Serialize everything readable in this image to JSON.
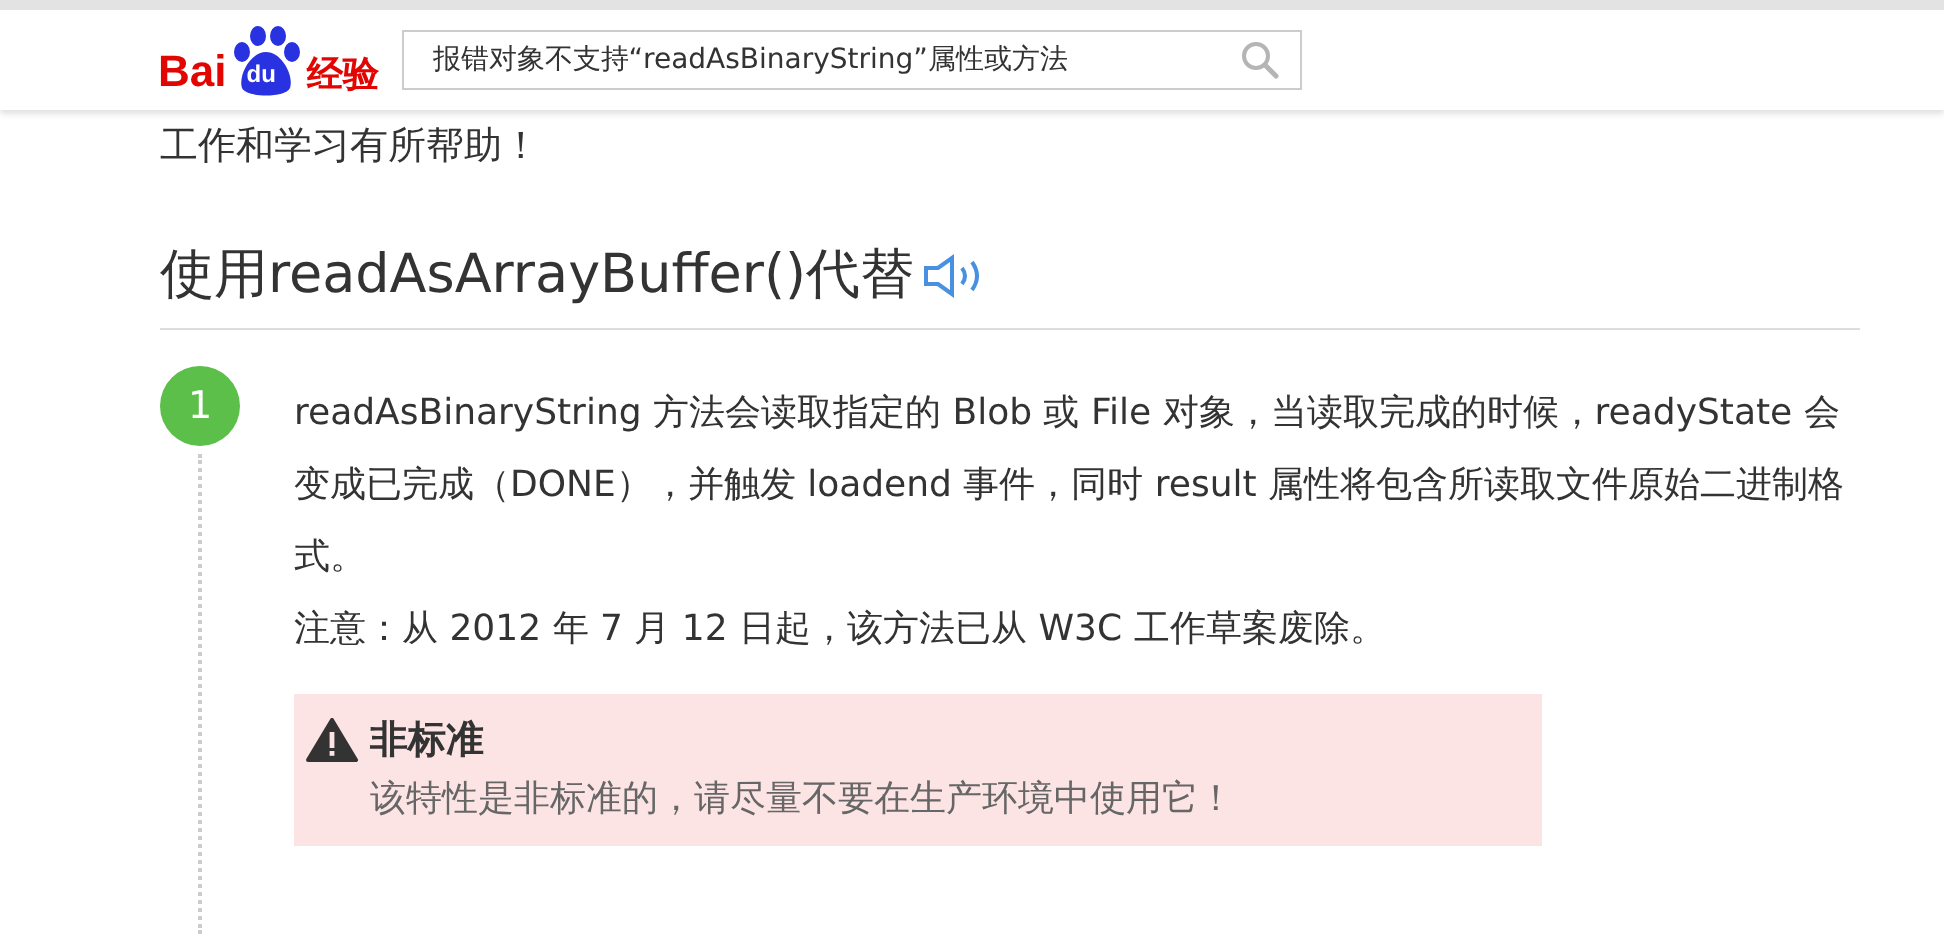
{
  "header": {
    "logo": {
      "part_1": "Bai",
      "part_2": "du",
      "part_3": "经验"
    },
    "search": {
      "value": "报错对象不支持“readAsBinaryString”属性或方法"
    }
  },
  "intro_tail": "工作和学习有所帮助！",
  "section": {
    "heading": "使用readAsArrayBuffer()代替",
    "steps": [
      {
        "number": "1",
        "paragraphs": [
          "readAsBinaryString 方法会读取指定的 Blob 或 File 对象，当读取完成的时候，readyState  会变成已完成（DONE），并触发 loadend 事件，同时 result 属性将包含所读取文件原始二进制格式。",
          "注意：从 2012 年 7 月 12 日起，该方法已从 W3C 工作草案废除。"
        ],
        "notice": {
          "title": "非标准",
          "text": "该特性是非标准的，请尽量不要在生产环境中使用它！"
        }
      }
    ]
  }
}
